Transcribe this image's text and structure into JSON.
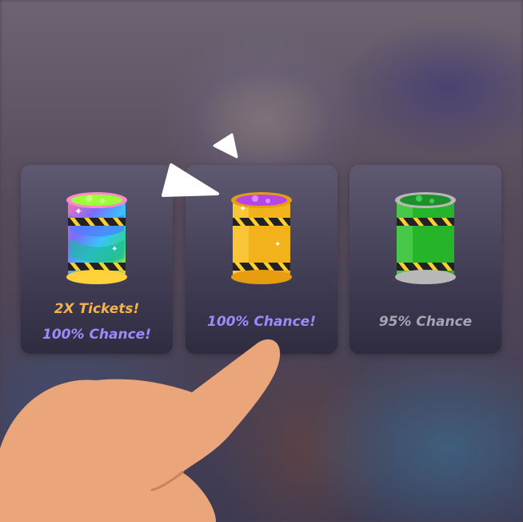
{
  "cards": [
    {
      "name": "rainbow-can",
      "line1": "2X Tickets!",
      "line2": "100% Chance!"
    },
    {
      "name": "gold-can",
      "line1": "100% Chance!"
    },
    {
      "name": "green-can",
      "line1": "95% Chance"
    }
  ],
  "colors": {
    "tickets": "#f6b24a",
    "chance_purple": "#9a8cff",
    "chance_gray": "#a8a4b4",
    "skin": "#eaa57a"
  }
}
